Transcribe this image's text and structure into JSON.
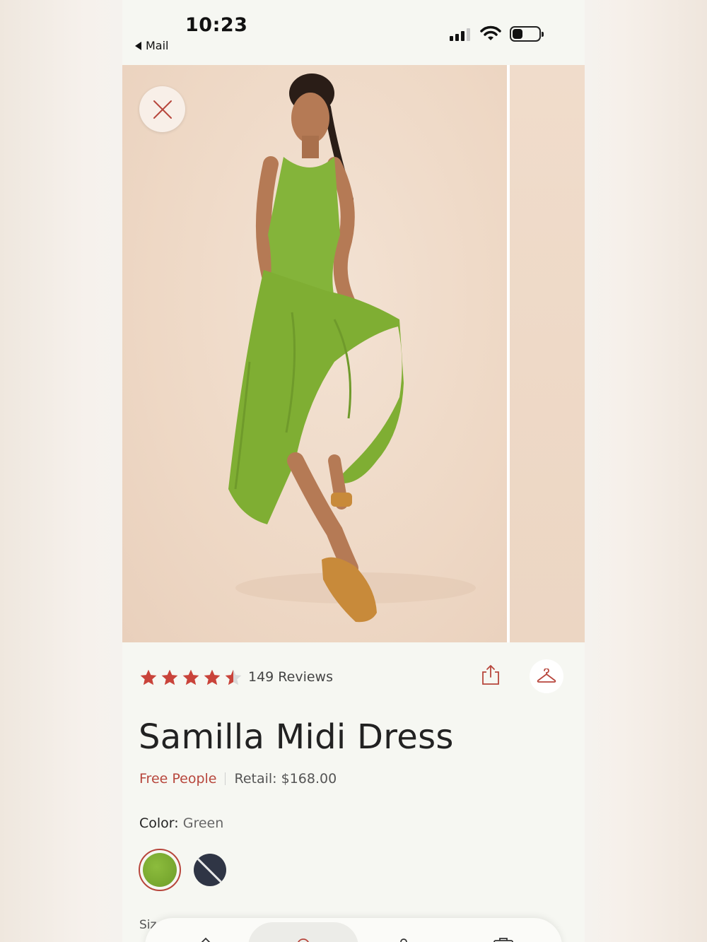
{
  "status_bar": {
    "time": "10:23",
    "back_label": "Mail",
    "back_icon": "back-triangle-icon",
    "signal_icon": "cellular-signal-icon",
    "wifi_icon": "wifi-icon",
    "battery_icon": "battery-icon"
  },
  "gallery": {
    "close_icon": "close-icon",
    "main_image": "model-in-green-midi-dress-photo",
    "next_image": "next-product-photo-peek"
  },
  "product": {
    "rating": 4.5,
    "rating_max": 5,
    "reviews_label": "149 Reviews",
    "share_icon": "share-icon",
    "hanger_icon": "hanger-icon",
    "title": "Samilla Midi Dress",
    "brand": "Free People",
    "retail": "Retail: $168.00",
    "color_label": "Color:",
    "color_value": "Green",
    "swatches": [
      {
        "name": "Green",
        "hex": "#7fae33",
        "selected": true
      },
      {
        "name": "Navy",
        "hex": "#2f3545",
        "selected": false,
        "unavailable": true
      }
    ],
    "size_label": "Siz"
  },
  "colors": {
    "accent": "#b7463c",
    "star": "#c9433a",
    "background": "#f6f7f2"
  }
}
